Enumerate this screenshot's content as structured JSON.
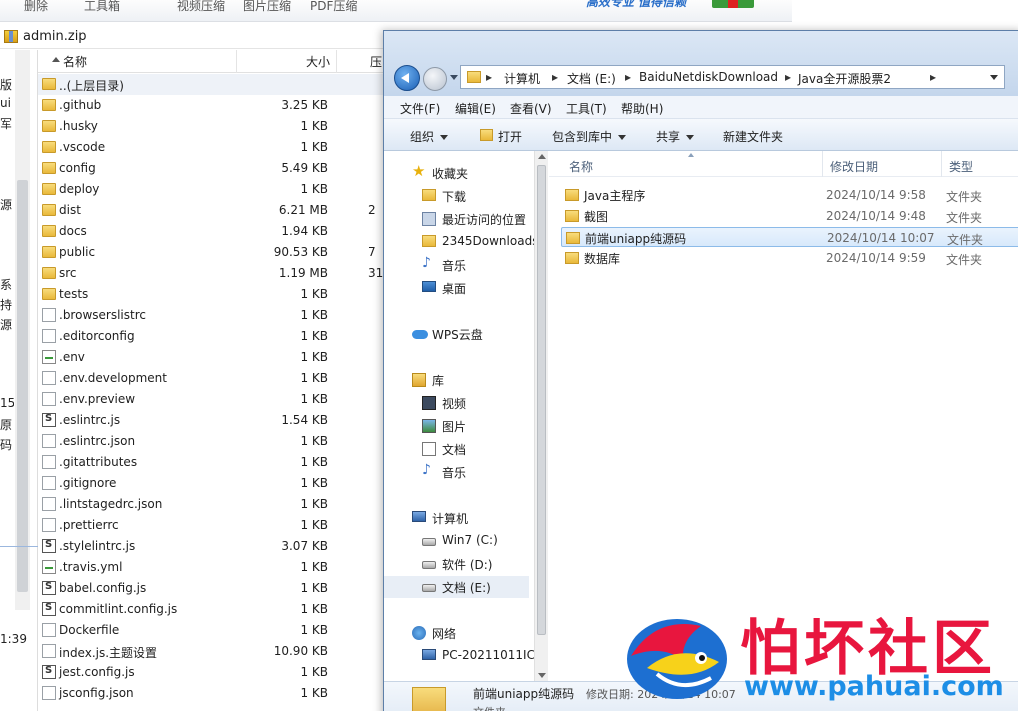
{
  "archive": {
    "toolbar": [
      "删除",
      "工具箱",
      "视频压缩",
      "图片压缩",
      "PDF压缩"
    ],
    "brand_text": "高效专业 值得信赖",
    "filename": "admin.zip",
    "extra": "",
    "left_fragments": [
      "版",
      "ui",
      "军",
      "源",
      "系",
      "持",
      "源",
      "15",
      "原",
      "码",
      "1:39"
    ],
    "columns": {
      "name": "名称",
      "size": "大小",
      "compressed": "压"
    },
    "rows": [
      {
        "name": "..(上层目录)",
        "type": "folder",
        "size": "",
        "c": ""
      },
      {
        "name": ".github",
        "type": "folder",
        "size": "3.25 KB",
        "c": ""
      },
      {
        "name": ".husky",
        "type": "folder",
        "size": "1 KB",
        "c": ""
      },
      {
        "name": ".vscode",
        "type": "folder",
        "size": "1 KB",
        "c": ""
      },
      {
        "name": "config",
        "type": "folder",
        "size": "5.49 KB",
        "c": ""
      },
      {
        "name": "deploy",
        "type": "folder",
        "size": "1 KB",
        "c": ""
      },
      {
        "name": "dist",
        "type": "folder",
        "size": "6.21 MB",
        "c": "2"
      },
      {
        "name": "docs",
        "type": "folder",
        "size": "1.94 KB",
        "c": ""
      },
      {
        "name": "public",
        "type": "folder",
        "size": "90.53 KB",
        "c": "7"
      },
      {
        "name": "src",
        "type": "folder",
        "size": "1.19 MB",
        "c": "31"
      },
      {
        "name": "tests",
        "type": "folder",
        "size": "1 KB",
        "c": ""
      },
      {
        "name": ".browserslistrc",
        "type": "file",
        "size": "1 KB",
        "c": ""
      },
      {
        "name": ".editorconfig",
        "type": "file",
        "size": "1 KB",
        "c": ""
      },
      {
        "name": ".env",
        "type": "env",
        "size": "1 KB",
        "c": ""
      },
      {
        "name": ".env.development",
        "type": "file",
        "size": "1 KB",
        "c": ""
      },
      {
        "name": ".env.preview",
        "type": "file",
        "size": "1 KB",
        "c": ""
      },
      {
        "name": ".eslintrc.js",
        "type": "js",
        "size": "1.54 KB",
        "c": ""
      },
      {
        "name": ".eslintrc.json",
        "type": "file",
        "size": "1 KB",
        "c": ""
      },
      {
        "name": ".gitattributes",
        "type": "file",
        "size": "1 KB",
        "c": ""
      },
      {
        "name": ".gitignore",
        "type": "file",
        "size": "1 KB",
        "c": ""
      },
      {
        "name": ".lintstagedrc.json",
        "type": "file",
        "size": "1 KB",
        "c": ""
      },
      {
        "name": ".prettierrc",
        "type": "file",
        "size": "1 KB",
        "c": ""
      },
      {
        "name": ".stylelintrc.js",
        "type": "js",
        "size": "3.07 KB",
        "c": ""
      },
      {
        "name": ".travis.yml",
        "type": "env",
        "size": "1 KB",
        "c": ""
      },
      {
        "name": "babel.config.js",
        "type": "js",
        "size": "1 KB",
        "c": ""
      },
      {
        "name": "commitlint.config.js",
        "type": "js",
        "size": "1 KB",
        "c": ""
      },
      {
        "name": "Dockerfile",
        "type": "file",
        "size": "1 KB",
        "c": ""
      },
      {
        "name": "index.js.主题设置",
        "type": "file",
        "size": "10.90 KB",
        "c": ""
      },
      {
        "name": "jest.config.js",
        "type": "js",
        "size": "1 KB",
        "c": ""
      },
      {
        "name": "jsconfig.json",
        "type": "file",
        "size": "1 KB",
        "c": ""
      }
    ]
  },
  "explorer": {
    "breadcrumbs": [
      "计算机",
      "文档 (E:)",
      "BaiduNetdiskDownload",
      "Java全开源股票2"
    ],
    "menu": [
      "文件(F)",
      "编辑(E)",
      "查看(V)",
      "工具(T)",
      "帮助(H)"
    ],
    "commands": [
      "组织",
      "打开",
      "包含到库中",
      "共享",
      "新建文件夹"
    ],
    "nav": [
      {
        "label": "收藏夹",
        "icon": "star",
        "indent": 0,
        "y": 0
      },
      {
        "label": "下载",
        "icon": "folder",
        "indent": 1
      },
      {
        "label": "最近访问的位置",
        "icon": "recent",
        "indent": 1
      },
      {
        "label": "2345Downloads",
        "icon": "folder",
        "indent": 1
      },
      {
        "label": "音乐",
        "icon": "music",
        "indent": 1
      },
      {
        "label": "桌面",
        "icon": "desk",
        "indent": 1
      },
      {
        "label": "WPS云盘",
        "icon": "cloud",
        "indent": 0
      },
      {
        "label": "库",
        "icon": "lib",
        "indent": 0
      },
      {
        "label": "视频",
        "icon": "video",
        "indent": 1
      },
      {
        "label": "图片",
        "icon": "pic",
        "indent": 1
      },
      {
        "label": "文档",
        "icon": "doc",
        "indent": 1
      },
      {
        "label": "音乐",
        "icon": "music",
        "indent": 1
      },
      {
        "label": "计算机",
        "icon": "comp",
        "indent": 0
      },
      {
        "label": "Win7 (C:)",
        "icon": "drive",
        "indent": 1
      },
      {
        "label": "软件 (D:)",
        "icon": "drive",
        "indent": 1
      },
      {
        "label": "文档 (E:)",
        "icon": "drive",
        "indent": 1,
        "selected": true
      },
      {
        "label": "网络",
        "icon": "net",
        "indent": 0
      },
      {
        "label": "PC-20211011IC",
        "icon": "pc",
        "indent": 1
      }
    ],
    "columns": {
      "name": "名称",
      "date": "修改日期",
      "type": "类型"
    },
    "files": [
      {
        "name": "Java主程序",
        "date": "2024/10/14 9:58",
        "type": "文件夹"
      },
      {
        "name": "截图",
        "date": "2024/10/14 9:48",
        "type": "文件夹"
      },
      {
        "name": "前端uniapp纯源码",
        "date": "2024/10/14 10:07",
        "type": "文件夹",
        "selected": true
      },
      {
        "name": "数据库",
        "date": "2024/10/14 9:59",
        "type": "文件夹"
      }
    ],
    "details": {
      "name": "前端uniapp纯源码",
      "modified": "修改日期: 2024/10/14 10:07",
      "type": "文件夹"
    }
  },
  "watermark": {
    "text_cn": "怕坏社区",
    "url": "www.pahuai.com"
  }
}
